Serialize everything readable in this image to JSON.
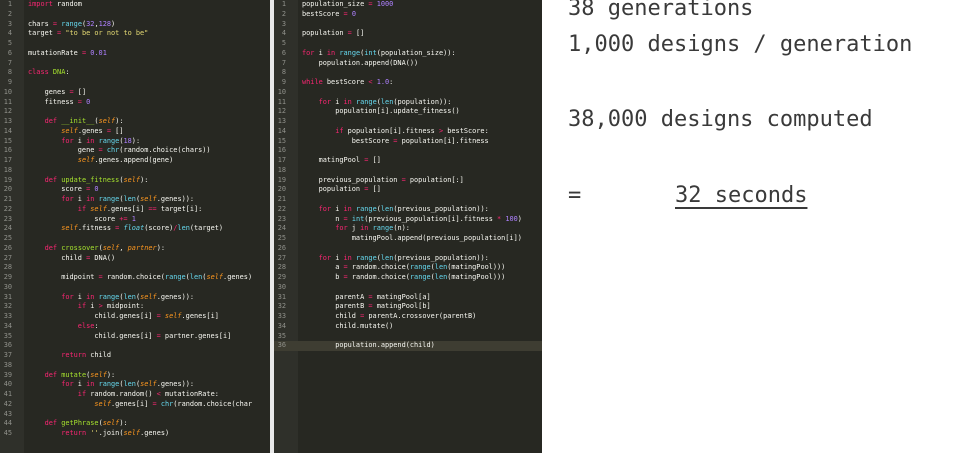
{
  "left_editor": {
    "lines": [
      {
        "n": "1",
        "t": "import random"
      },
      {
        "n": "2",
        "t": ""
      },
      {
        "n": "3",
        "t": "chars = range(32,128)"
      },
      {
        "n": "4",
        "t": "target = \"to be or not to be\""
      },
      {
        "n": "5",
        "t": ""
      },
      {
        "n": "6",
        "t": "mutationRate = 0.01"
      },
      {
        "n": "7",
        "t": ""
      },
      {
        "n": "8",
        "t": "class DNA:"
      },
      {
        "n": "9",
        "t": ""
      },
      {
        "n": "10",
        "t": "    genes = []"
      },
      {
        "n": "11",
        "t": "    fitness = 0"
      },
      {
        "n": "12",
        "t": ""
      },
      {
        "n": "13",
        "t": "    def __init__(self):"
      },
      {
        "n": "14",
        "t": "        self.genes = []"
      },
      {
        "n": "15",
        "t": "        for i in range(18):"
      },
      {
        "n": "16",
        "t": "            gene = chr(random.choice(chars))"
      },
      {
        "n": "17",
        "t": "            self.genes.append(gene)"
      },
      {
        "n": "18",
        "t": ""
      },
      {
        "n": "19",
        "t": "    def update_fitness(self):"
      },
      {
        "n": "20",
        "t": "        score = 0"
      },
      {
        "n": "21",
        "t": "        for i in range(len(self.genes)):"
      },
      {
        "n": "22",
        "t": "            if self.genes[i] == target[i]:"
      },
      {
        "n": "23",
        "t": "                score += 1"
      },
      {
        "n": "24",
        "t": "        self.fitness = float(score)/len(target)"
      },
      {
        "n": "25",
        "t": ""
      },
      {
        "n": "26",
        "t": "    def crossover(self, partner):"
      },
      {
        "n": "27",
        "t": "        child = DNA()"
      },
      {
        "n": "28",
        "t": ""
      },
      {
        "n": "29",
        "t": "        midpoint = random.choice(range(len(self.genes)"
      },
      {
        "n": "30",
        "t": ""
      },
      {
        "n": "31",
        "t": "        for i in range(len(self.genes)):"
      },
      {
        "n": "32",
        "t": "            if i > midpoint:"
      },
      {
        "n": "33",
        "t": "                child.genes[i] = self.genes[i]"
      },
      {
        "n": "34",
        "t": "            else:"
      },
      {
        "n": "35",
        "t": "                child.genes[i] = partner.genes[i]"
      },
      {
        "n": "36",
        "t": ""
      },
      {
        "n": "37",
        "t": "        return child"
      },
      {
        "n": "38",
        "t": ""
      },
      {
        "n": "39",
        "t": "    def mutate(self):"
      },
      {
        "n": "40",
        "t": "        for i in range(len(self.genes)):"
      },
      {
        "n": "41",
        "t": "            if random.random() < mutationRate:"
      },
      {
        "n": "42",
        "t": "                self.genes[i] = chr(random.choice(char"
      },
      {
        "n": "43",
        "t": ""
      },
      {
        "n": "44",
        "t": "    def getPhrase(self):"
      },
      {
        "n": "45",
        "t": "        return ''.join(self.genes)"
      }
    ]
  },
  "right_editor": {
    "current_line": "36",
    "lines": [
      {
        "n": "1",
        "t": "population_size = 1000"
      },
      {
        "n": "2",
        "t": "bestScore = 0"
      },
      {
        "n": "3",
        "t": ""
      },
      {
        "n": "4",
        "t": "population = []"
      },
      {
        "n": "5",
        "t": ""
      },
      {
        "n": "6",
        "t": "for i in range(int(population_size)):"
      },
      {
        "n": "7",
        "t": "    population.append(DNA())"
      },
      {
        "n": "8",
        "t": ""
      },
      {
        "n": "9",
        "t": "while bestScore < 1.0:"
      },
      {
        "n": "10",
        "t": ""
      },
      {
        "n": "11",
        "t": "    for i in range(len(population)):"
      },
      {
        "n": "12",
        "t": "        population[i].update_fitness()"
      },
      {
        "n": "13",
        "t": ""
      },
      {
        "n": "14",
        "t": "        if population[i].fitness > bestScore:"
      },
      {
        "n": "15",
        "t": "            bestScore = population[i].fitness"
      },
      {
        "n": "16",
        "t": ""
      },
      {
        "n": "17",
        "t": "    matingPool = []"
      },
      {
        "n": "18",
        "t": ""
      },
      {
        "n": "19",
        "t": "    previous_population = population[:]"
      },
      {
        "n": "20",
        "t": "    population = []"
      },
      {
        "n": "21",
        "t": ""
      },
      {
        "n": "22",
        "t": "    for i in range(len(previous_population)):"
      },
      {
        "n": "23",
        "t": "        n = int(previous_population[i].fitness * 100)"
      },
      {
        "n": "24",
        "t": "        for j in range(n):"
      },
      {
        "n": "25",
        "t": "            matingPool.append(previous_population[i])"
      },
      {
        "n": "26",
        "t": ""
      },
      {
        "n": "27",
        "t": "    for i in range(len(previous_population)):"
      },
      {
        "n": "28",
        "t": "        a = random.choice(range(len(matingPool)))"
      },
      {
        "n": "29",
        "t": "        b = random.choice(range(len(matingPool)))"
      },
      {
        "n": "30",
        "t": ""
      },
      {
        "n": "31",
        "t": "        parentA = matingPool[a]"
      },
      {
        "n": "32",
        "t": "        parentB = matingPool[b]"
      },
      {
        "n": "33",
        "t": "        child = parentA.crossover(parentB)"
      },
      {
        "n": "34",
        "t": "        child.mutate()"
      },
      {
        "n": "35",
        "t": ""
      },
      {
        "n": "36",
        "t": "        population.append(child)"
      }
    ]
  },
  "notes": {
    "generations": "38 generations",
    "per_generation": "1,000 designs / generation",
    "total": "38,000 designs computed",
    "equals": "=",
    "time": "32 seconds"
  },
  "theme": {
    "editor_bg": "#272822",
    "current_line_bg": "#3e3d32",
    "keyword": "#f92672",
    "builtin": "#66d9ef",
    "function": "#a6e22e",
    "string": "#e6db74",
    "number": "#ae81ff",
    "self": "#fd971f",
    "note_text": "#3a3a3a"
  }
}
